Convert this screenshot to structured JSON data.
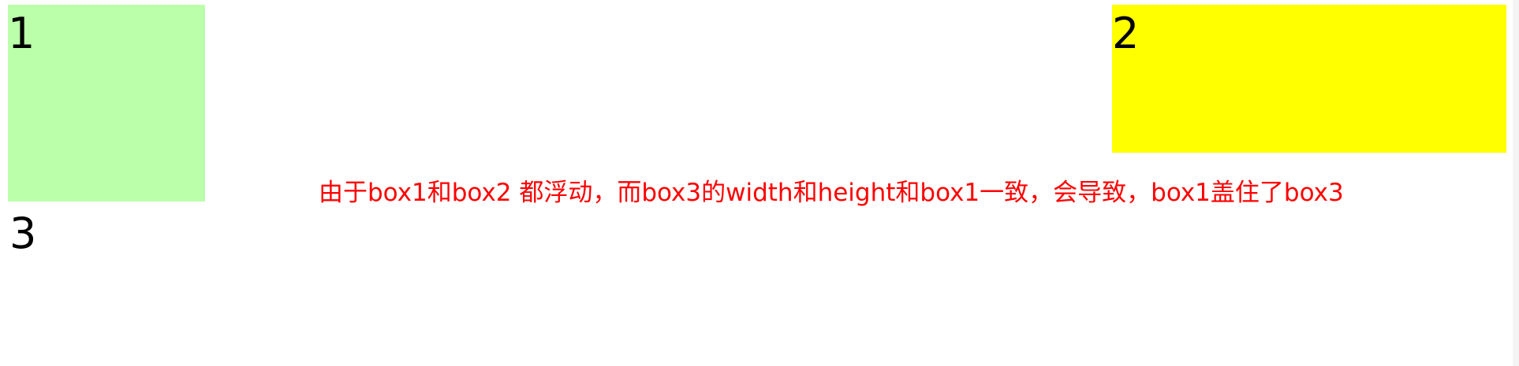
{
  "colors": {
    "background": "#ffffff",
    "box1": "#bbffaa",
    "box2": "#ffff00",
    "note": "#ff0000",
    "text": "#000000"
  },
  "box1": {
    "label": "1"
  },
  "box2": {
    "label": "2"
  },
  "box3": {
    "label": "3"
  },
  "note": {
    "text": "由于box1和box2 都浮动，而box3的width和height和box1一致，会导致，box1盖住了box3"
  }
}
